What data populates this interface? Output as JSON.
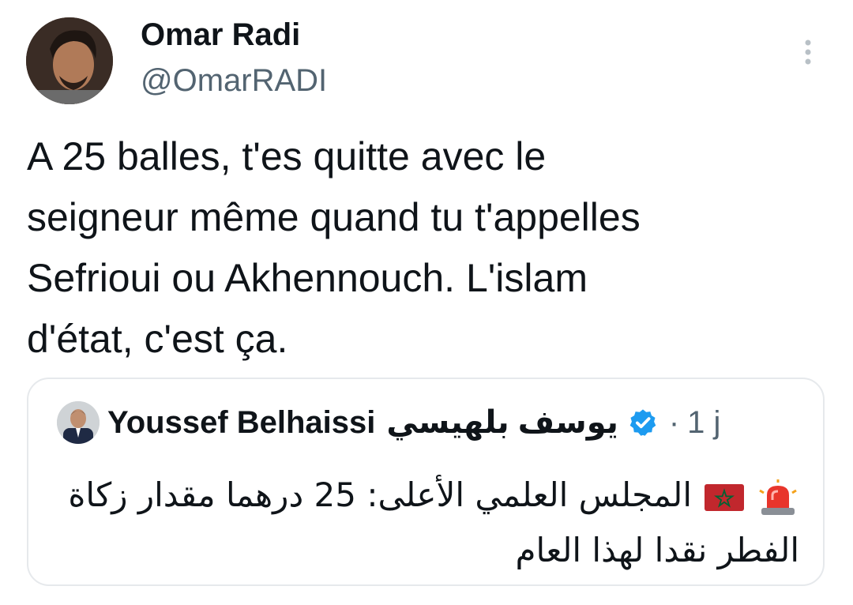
{
  "tweet": {
    "author_name": "Omar Radi",
    "author_handle": "@OmarRADI",
    "text": "A 25 balles, t'es quitte avec le\nseigneur même quand tu t'appelles\nSefrioui ou Akhennouch. L'islam\nd'état, c'est ça.",
    "more_icon": "more-vertical-icon"
  },
  "quote": {
    "author_name": "Youssef Belhaissi",
    "author_name_ar": "يوسف بلهيسي",
    "verified": true,
    "separator": "·",
    "time": "1 j",
    "text": "المجلس العلمي الأعلى: 25 درهما مقدار زكاة الفطر نقدا لهذا العام",
    "emojis": [
      "rotating-light-icon",
      "morocco-flag-icon"
    ]
  },
  "colors": {
    "text_primary": "#0f1419",
    "text_secondary": "#536471",
    "verified_blue": "#1d9bf0",
    "border": "#e6e9ec"
  }
}
